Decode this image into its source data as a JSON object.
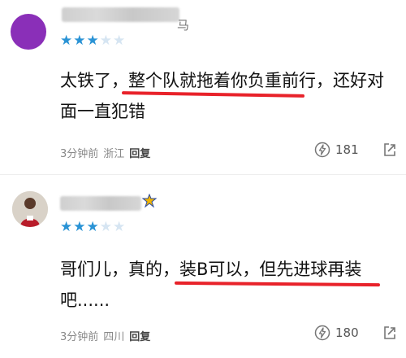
{
  "comments": [
    {
      "username_tail": "马",
      "rating_text": "★",
      "rating_filled": 3,
      "rating_total": 5,
      "text_before": "太铁了，",
      "text_highlight": "整个队就拖着你负重前行",
      "text_after": "，还好对面一直犯错",
      "time": "3分钟前",
      "location": "浙江",
      "reply_label": "回复",
      "likes": "181"
    },
    {
      "username_tail": "",
      "rating_text": "★",
      "rating_filled": 3,
      "rating_total": 5,
      "text_before": "哥们儿，真的，",
      "text_highlight": "装B可以，但先进球再装",
      "text_after": "吧......",
      "time": "3分钟前",
      "location": "四川",
      "reply_label": "回复",
      "likes": "180"
    }
  ],
  "colors": {
    "star_on": "#2a93d5",
    "star_off": "#d6e5f2",
    "underline": "#e8222a"
  },
  "icons": {
    "like": "lightning-like-icon",
    "share": "share-icon"
  }
}
